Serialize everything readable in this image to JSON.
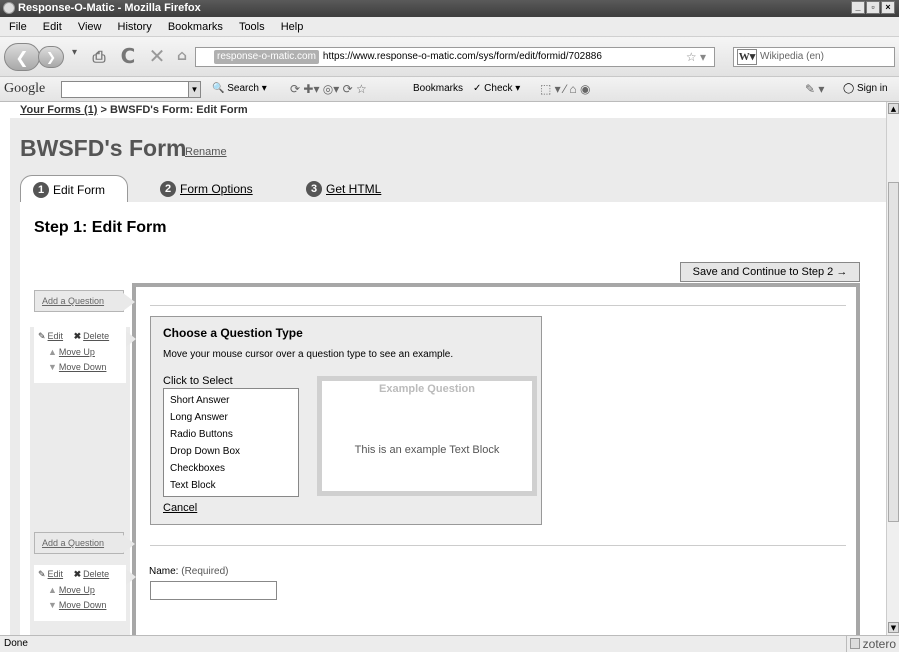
{
  "window": {
    "title": "Response-O-Matic - Mozilla Firefox"
  },
  "menu": [
    "File",
    "Edit",
    "View",
    "History",
    "Bookmarks",
    "Tools",
    "Help"
  ],
  "nav": {
    "domain_badge": "response-o-matic.com",
    "url": "https://www.response-o-matic.com/sys/form/edit/formid/702886",
    "search_engine": "Wikipedia (en)"
  },
  "google_toolbar": {
    "logo": "Google",
    "search": "Search",
    "bookmarks": "Bookmarks",
    "check": "Check",
    "signin": "Sign in"
  },
  "breadcrumb": {
    "link": "Your Forms (1)",
    "separator": " > ",
    "current": "BWSFD's Form: Edit Form"
  },
  "form": {
    "title": "BWSFD's Form",
    "rename": "Rename"
  },
  "tabs": [
    {
      "num": "1",
      "label": "Edit Form"
    },
    {
      "num": "2",
      "label": "Form Options"
    },
    {
      "num": "3",
      "label": "Get HTML"
    }
  ],
  "step_title": "Step 1: Edit Form",
  "save_button": "Save and Continue to Step 2 →",
  "add_question": "Add a Question",
  "controls": {
    "edit": "Edit",
    "delete": "Delete",
    "move_up": "Move Up",
    "move_down": "Move Down"
  },
  "chooser": {
    "title": "Choose a Question Type",
    "description": "Move your mouse cursor over a question type to see an example.",
    "click_label": "Click to Select",
    "options": [
      "Short Answer",
      "Long Answer",
      "Radio Buttons",
      "Drop Down Box",
      "Checkboxes",
      "Text Block"
    ],
    "cancel": "Cancel",
    "example_title": "Example Question",
    "example_text": "This is an example Text Block"
  },
  "name_field": {
    "label": "Name:",
    "required": "(Required)"
  },
  "status": {
    "text": "Done",
    "zotero": "zotero"
  }
}
